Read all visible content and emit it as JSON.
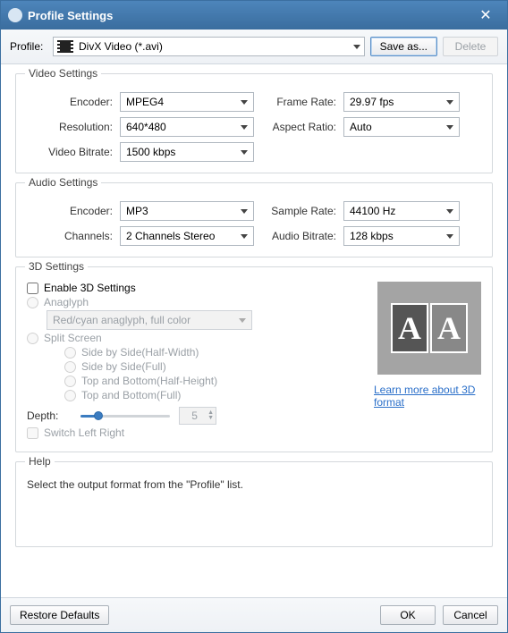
{
  "window": {
    "title": "Profile Settings"
  },
  "toolbar": {
    "profile_label": "Profile:",
    "profile_value": "DivX Video (*.avi)",
    "save_as": "Save as...",
    "delete": "Delete"
  },
  "video": {
    "legend": "Video Settings",
    "encoder_label": "Encoder:",
    "encoder_value": "MPEG4",
    "resolution_label": "Resolution:",
    "resolution_value": "640*480",
    "bitrate_label": "Video Bitrate:",
    "bitrate_value": "1500 kbps",
    "framerate_label": "Frame Rate:",
    "framerate_value": "29.97 fps",
    "aspect_label": "Aspect Ratio:",
    "aspect_value": "Auto"
  },
  "audio": {
    "legend": "Audio Settings",
    "encoder_label": "Encoder:",
    "encoder_value": "MP3",
    "channels_label": "Channels:",
    "channels_value": "2 Channels Stereo",
    "samplerate_label": "Sample Rate:",
    "samplerate_value": "44100 Hz",
    "bitrate_label": "Audio Bitrate:",
    "bitrate_value": "128 kbps"
  },
  "three_d": {
    "legend": "3D Settings",
    "enable_label": "Enable 3D Settings",
    "anaglyph_label": "Anaglyph",
    "anaglyph_option": "Red/cyan anaglyph, full color",
    "split_label": "Split Screen",
    "sbs_half": "Side by Side(Half-Width)",
    "sbs_full": "Side by Side(Full)",
    "tab_half": "Top and Bottom(Half-Height)",
    "tab_full": "Top and Bottom(Full)",
    "depth_label": "Depth:",
    "depth_value": "5",
    "switch_label": "Switch Left Right",
    "learn_more": "Learn more about 3D format"
  },
  "help": {
    "legend": "Help",
    "text": "Select the output format from the \"Profile\" list."
  },
  "footer": {
    "restore": "Restore Defaults",
    "ok": "OK",
    "cancel": "Cancel"
  }
}
